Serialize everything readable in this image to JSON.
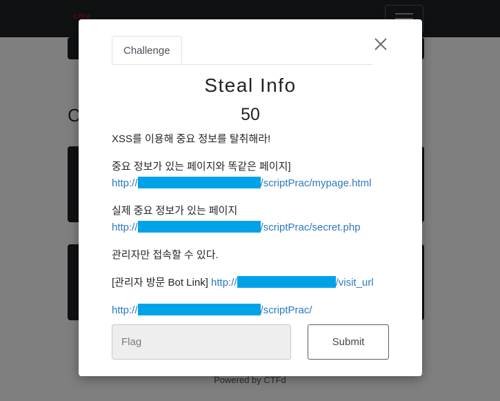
{
  "navbar": {
    "brand": "CTFd"
  },
  "background": {
    "heading": "C",
    "footer": "Powered by CTFd"
  },
  "modal": {
    "tab_label": "Challenge",
    "title": "Steal Info",
    "value": "50",
    "description": {
      "intro": "XSS를 이용해 중요 정보를 탈취해라!",
      "mypage_label": "중요 정보가 있는 페이지와 똑같은 페이지]",
      "mypage_link_prefix": "http://",
      "mypage_link_suffix": "/scriptPrac/mypage.html",
      "secret_label": "실제 중요 정보가 있는 페이지",
      "secret_link_prefix": "http://",
      "secret_link_suffix": "/scriptPrac/secret.php",
      "admin_note": "관리자만 접속할 수 있다.",
      "bot_label": "[관리자 방문 Bot Link]",
      "bot_link_prefix": "http://",
      "bot_link_suffix": "/visit_url",
      "base_link_prefix": "http://",
      "base_link_suffix": "/scriptPrac/"
    },
    "flag_placeholder": "Flag",
    "submit_label": "Submit"
  },
  "colors": {
    "link": "#2a79c0",
    "redaction": "#00a2e8",
    "navbar": "#202226"
  },
  "icons": {
    "close": "close-icon",
    "menu": "hamburger-menu-icon"
  }
}
